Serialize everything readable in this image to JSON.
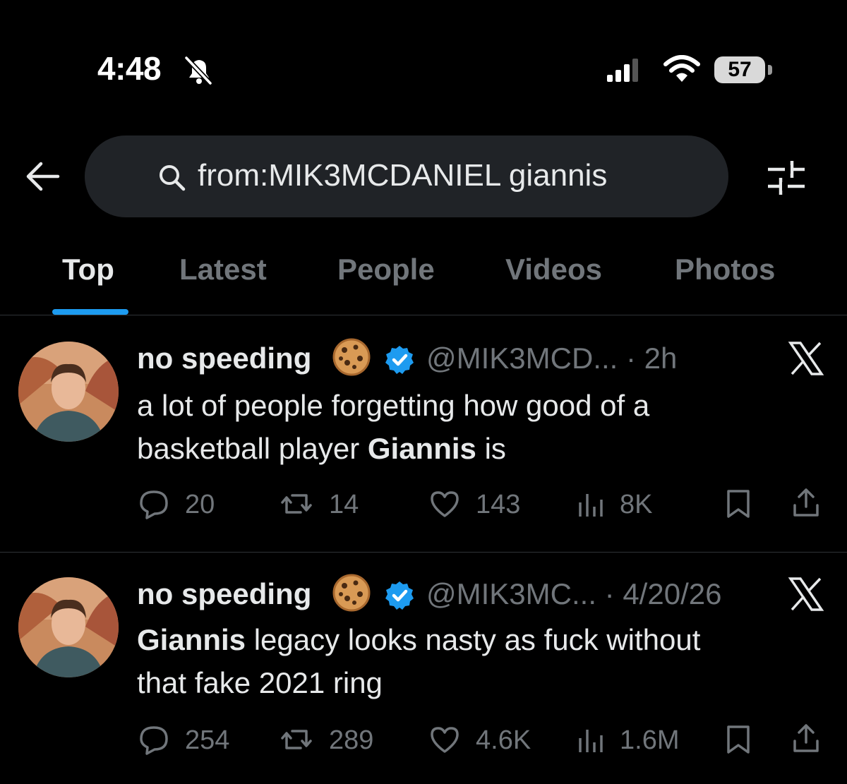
{
  "status_bar": {
    "time": "4:48",
    "battery": "57"
  },
  "search": {
    "query": "from:MIK3MCDANIEL giannis"
  },
  "tabs": [
    {
      "label": "Top"
    },
    {
      "label": "Latest"
    },
    {
      "label": "People"
    },
    {
      "label": "Videos"
    },
    {
      "label": "Photos"
    }
  ],
  "tweets": [
    {
      "name": "no speeding",
      "handle": "@MIK3MCD...",
      "time": "· 2h",
      "text_1": "a lot of people forgetting how good of a",
      "text_2a": "basketball player ",
      "text_2b": "Giannis",
      "text_2c": " is",
      "replies": "20",
      "reposts": "14",
      "likes": "143",
      "views": "8K"
    },
    {
      "name": "no speeding",
      "handle": "@MIK3MC...",
      "time": "· 4/20/26",
      "text_1a": "Giannis",
      "text_1b": " legacy looks nasty as fuck without",
      "text_2": "that fake 2021 ring",
      "replies": "254",
      "reposts": "289",
      "likes": "4.6K",
      "views": "1.6M"
    }
  ],
  "colors": {
    "accent": "#1d9bf0",
    "muted": "#71767b",
    "text": "#e7e9ea",
    "background": "#000000"
  },
  "icons": [
    "bell-slash-icon",
    "signal-icon",
    "wifi-icon",
    "battery-icon",
    "back-arrow-icon",
    "search-icon",
    "filter-icon",
    "cookie-emoji-icon",
    "verified-badge-icon",
    "x-logo-icon",
    "reply-icon",
    "repost-icon",
    "like-icon",
    "views-icon",
    "bookmark-icon",
    "share-icon"
  ]
}
